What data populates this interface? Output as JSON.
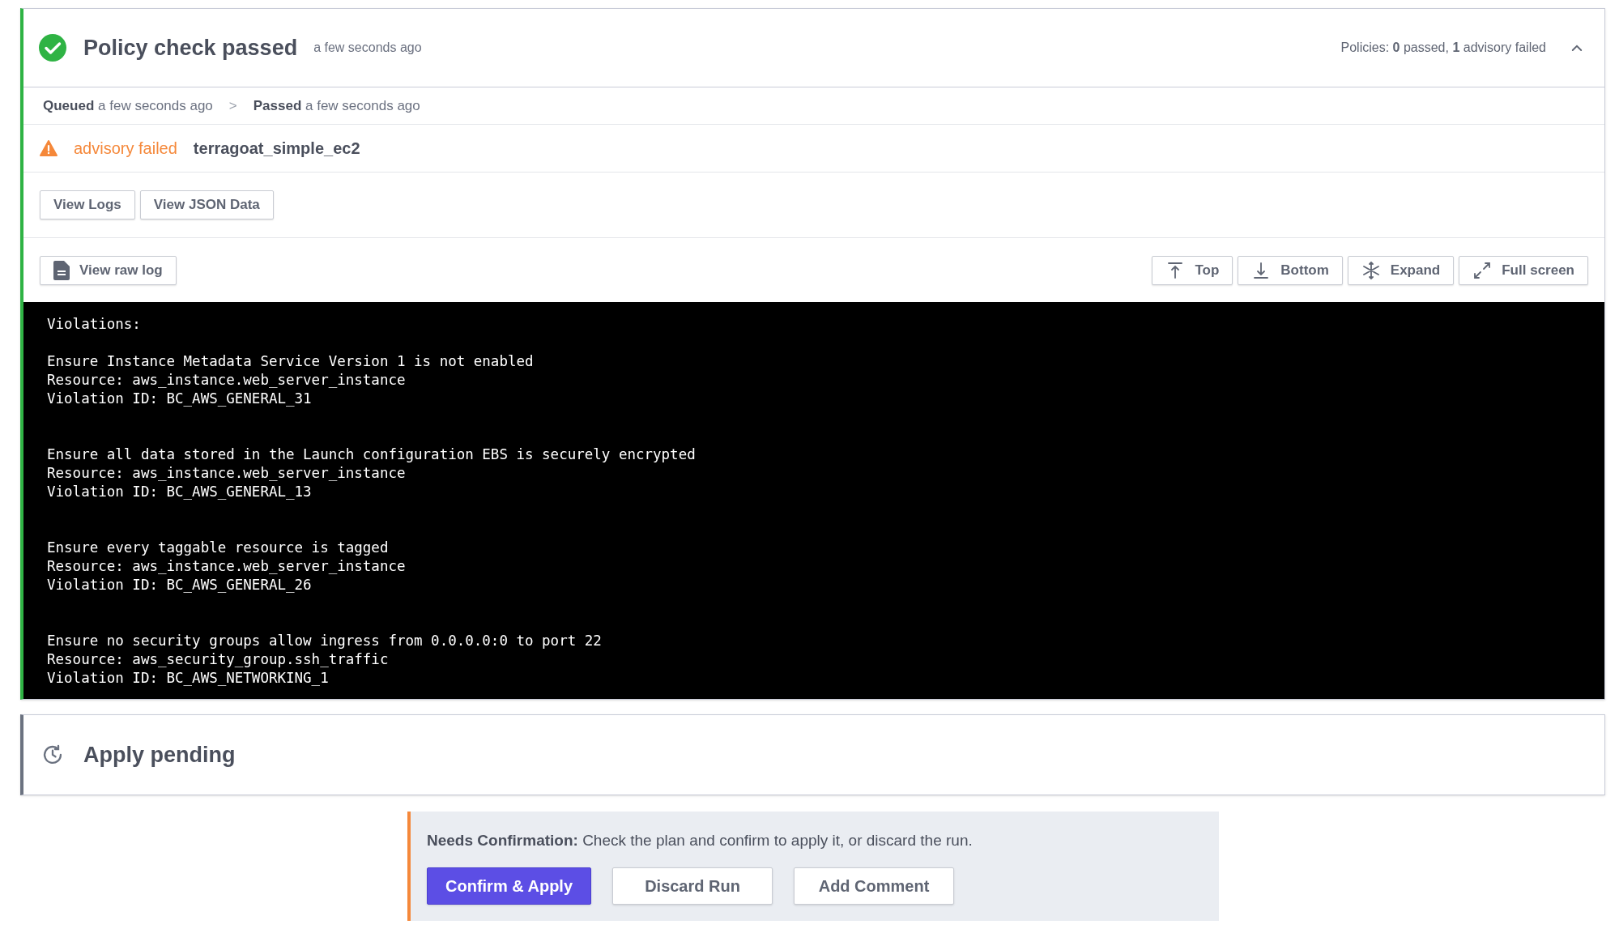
{
  "policy_check": {
    "kind": "passed",
    "title": "Policy check passed",
    "time": "a few seconds ago",
    "summary": "Policies: **0** passed, **1** advisory failed",
    "expanded": true,
    "timeline": [
      {
        "label": "Queued",
        "time": "a few seconds ago"
      },
      {
        "label": "Passed",
        "time": "a few seconds ago"
      }
    ],
    "timeline_separator": ">",
    "results": [
      {
        "status": "advisory failed",
        "name": "terragoat_simple_ec2"
      }
    ],
    "buttons": [
      "View Logs",
      "View JSON Data"
    ],
    "log_toolbar": {
      "raw_log": "View raw log",
      "actions": [
        {
          "kind": "top",
          "label": "Top"
        },
        {
          "kind": "bottom",
          "label": "Bottom"
        },
        {
          "kind": "expand",
          "label": "Expand"
        },
        {
          "kind": "fullscreen",
          "label": "Full screen"
        }
      ]
    },
    "log": {
      "heading": "Violations:",
      "violations": [
        {
          "lines": [
            "Ensure Instance Metadata Service Version 1 is not enabled",
            "Resource: aws_instance.web_server_instance",
            "Violation ID: BC_AWS_GENERAL_31"
          ]
        },
        {
          "lines": [
            "Ensure all data stored in the Launch configuration EBS is securely encrypted",
            "Resource: aws_instance.web_server_instance",
            "Violation ID: BC_AWS_GENERAL_13"
          ]
        },
        {
          "lines": [
            "Ensure every taggable resource is tagged",
            "Resource: aws_instance.web_server_instance",
            "Violation ID: BC_AWS_GENERAL_26"
          ]
        },
        {
          "lines": [
            "Ensure no security groups allow ingress from 0.0.0.0:0 to port 22",
            "Resource: aws_security_group.ssh_traffic",
            "Violation ID: BC_AWS_NETWORKING_1"
          ]
        }
      ]
    }
  },
  "apply": {
    "kind": "pending",
    "title": "Apply pending"
  },
  "confirmation": {
    "message": "**Needs Confirmation:** Check the plan and confirm to apply it, or discard the run.",
    "buttons": [
      {
        "kind": "primary",
        "label": "Confirm & Apply"
      },
      {
        "kind": "secondary",
        "label": "Discard Run"
      },
      {
        "kind": "secondary",
        "label": "Add Comment"
      }
    ]
  }
}
